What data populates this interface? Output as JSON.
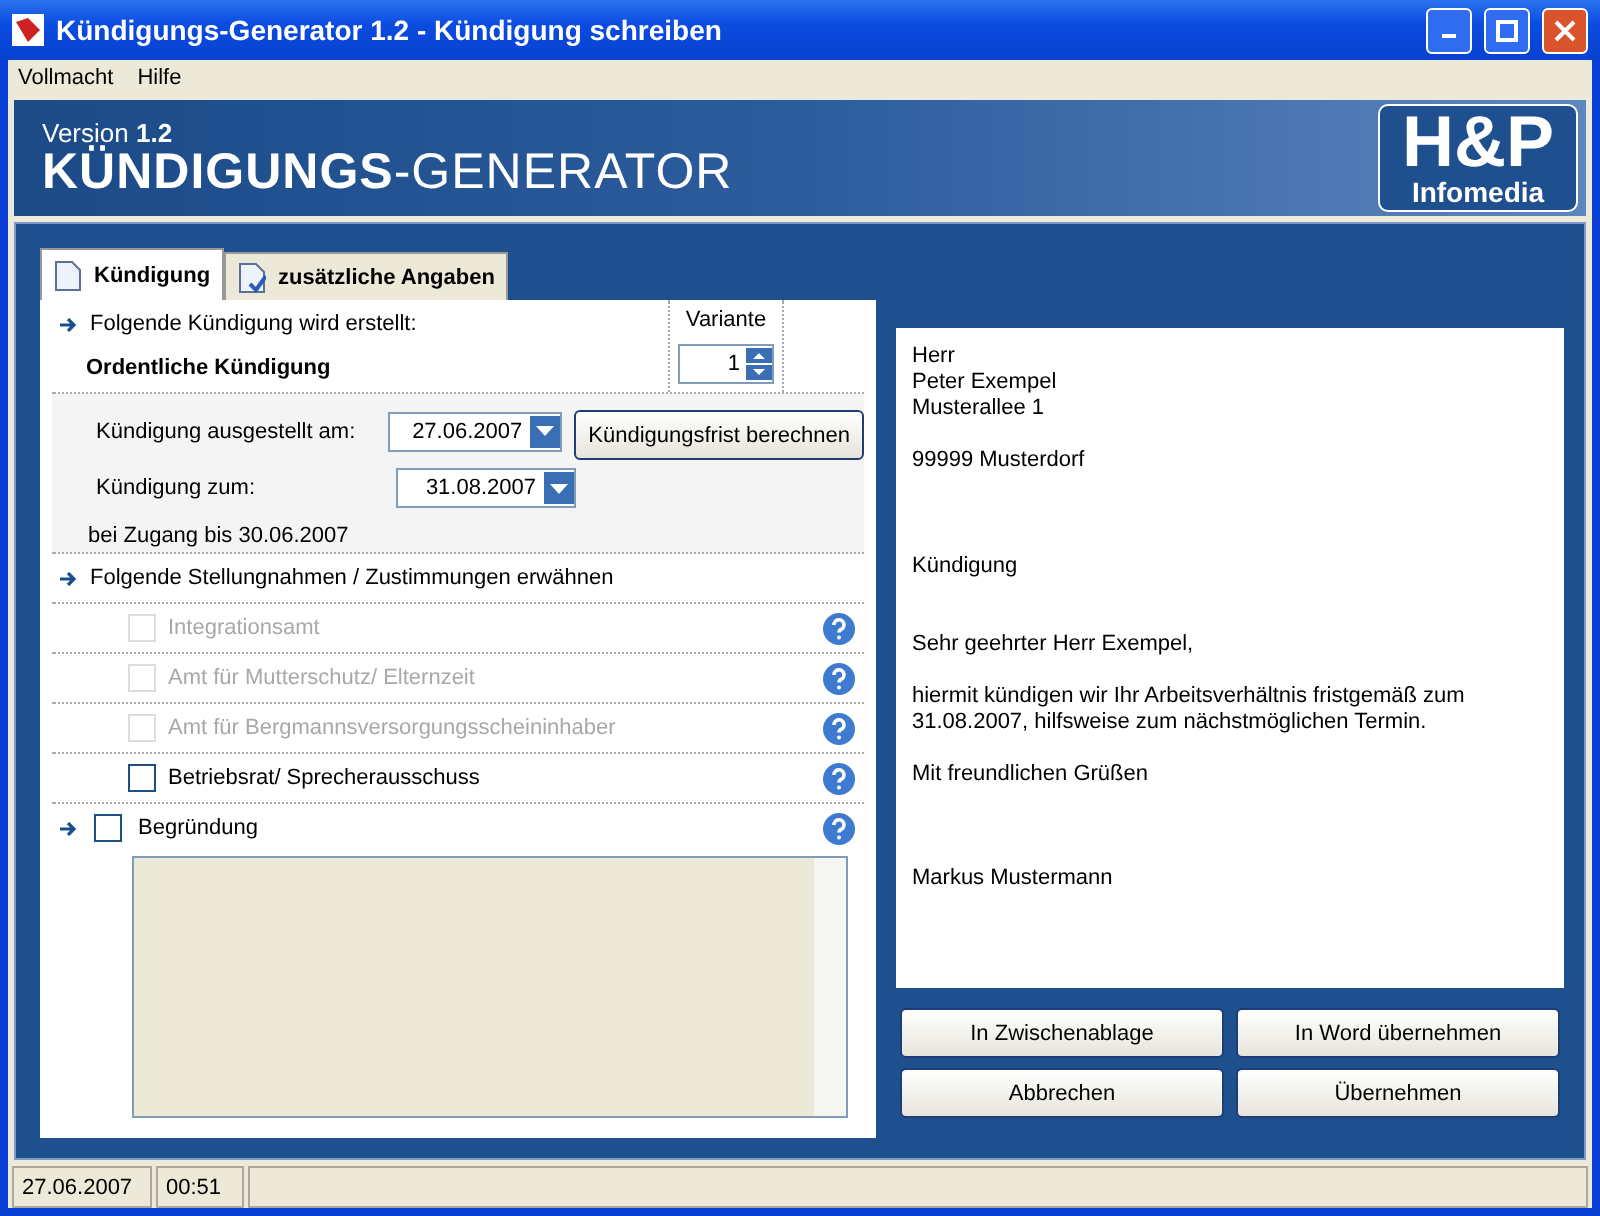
{
  "window": {
    "title": "Kündigungs-Generator 1.2 - Kündigung schreiben"
  },
  "menu": [
    "Vollmacht",
    "Hilfe"
  ],
  "banner": {
    "version": "Version **1.2**",
    "product": "**KÜNDIGUNGS**-GENERATOR",
    "logo_main": "H&P",
    "logo_sub": "Infomedia"
  },
  "tabs": [
    {
      "label": "Kündigung",
      "selected": true
    },
    {
      "label": "zusätzliche Angaben",
      "selected": false
    }
  ],
  "form": {
    "intro": "Folgende Kündigung wird erstellt:",
    "type": "Ordentliche Kündigung",
    "variant_label": "Variante",
    "variant_value": "1",
    "dates": [
      {
        "label": "Kündigung ausgestellt am:",
        "value": "27.06.2007"
      },
      {
        "label": "Kündigung zum:",
        "value": "31.08.2007"
      }
    ],
    "calc_button": "Kündigungsfrist berechnen",
    "receipt_note": "bei Zugang bis 30.06.2007",
    "statements_heading": "Folgende Stellungnahmen / Zustimmungen erwähnen",
    "statements": [
      {
        "label": "Integrationsamt",
        "checked": false,
        "disabled": true
      },
      {
        "label": "Amt für Mutterschutz/ Elternzeit",
        "checked": false,
        "disabled": true
      },
      {
        "label": "Amt für Bergmannsversorgungsscheininhaber",
        "checked": false,
        "disabled": true
      },
      {
        "label": "Betriebsrat/ Sprecherausschuss",
        "checked": false,
        "disabled": false
      }
    ],
    "reason": {
      "label": "Begründung",
      "checked": false
    }
  },
  "letter": [
    {
      "kind": "recipient",
      "lines": [
        "Herr",
        "Peter Exempel",
        "Musterallee 1"
      ]
    },
    {
      "kind": "city",
      "lines": [
        "99999 Musterdorf"
      ]
    },
    {
      "kind": "subject",
      "lines": [
        "Kündigung"
      ]
    },
    {
      "kind": "salutation",
      "lines": [
        "Sehr geehrter Herr Exempel,"
      ]
    },
    {
      "kind": "body",
      "lines": [
        "hiermit kündigen wir Ihr Arbeitsverhältnis fristgemäß zum",
        "31.08.2007, hilfsweise zum nächstmöglichen Termin."
      ]
    },
    {
      "kind": "closing",
      "lines": [
        "Mit freundlichen Grüßen"
      ]
    },
    {
      "kind": "signature",
      "lines": [
        "Markus Mustermann"
      ]
    }
  ],
  "buttons": [
    "In Zwischenablage",
    "In Word übernehmen",
    "Abbrechen",
    "Übernehmen"
  ],
  "status_bar": [
    "27.06.2007",
    "00:51"
  ]
}
